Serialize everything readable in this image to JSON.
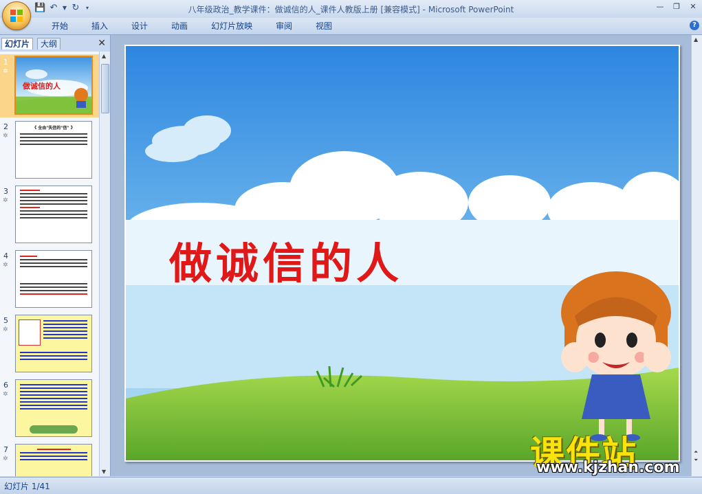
{
  "window": {
    "title": "八年级政治_教学课件：做诚信的人_课件人教版上册 [兼容模式]",
    "app_name": "Microsoft PowerPoint",
    "title_sep": " - "
  },
  "ribbon_tabs": [
    "开始",
    "插入",
    "设计",
    "动画",
    "幻灯片放映",
    "审阅",
    "视图"
  ],
  "panel": {
    "tab_slides": "幻灯片",
    "tab_outline": "大纲",
    "close": "✕"
  },
  "thumbnails": [
    {
      "num": "1",
      "selected": true
    },
    {
      "num": "2",
      "title": "《 全由\"失信的\"信\" 》"
    },
    {
      "num": "3"
    },
    {
      "num": "4"
    },
    {
      "num": "5"
    },
    {
      "num": "6"
    },
    {
      "num": "7"
    }
  ],
  "slide": {
    "title": "做诚信的人"
  },
  "status": {
    "slide_counter": "幻灯片 1/41"
  },
  "watermark": {
    "cn": "课件站",
    "url": "www.kjzhan.com"
  },
  "colors": {
    "sky_top": "#2d86e0",
    "sky_bottom": "#bfe2f6",
    "grass": "#7cc43a",
    "title_red": "#e01818",
    "watermark_yellow": "#f8e40c"
  }
}
